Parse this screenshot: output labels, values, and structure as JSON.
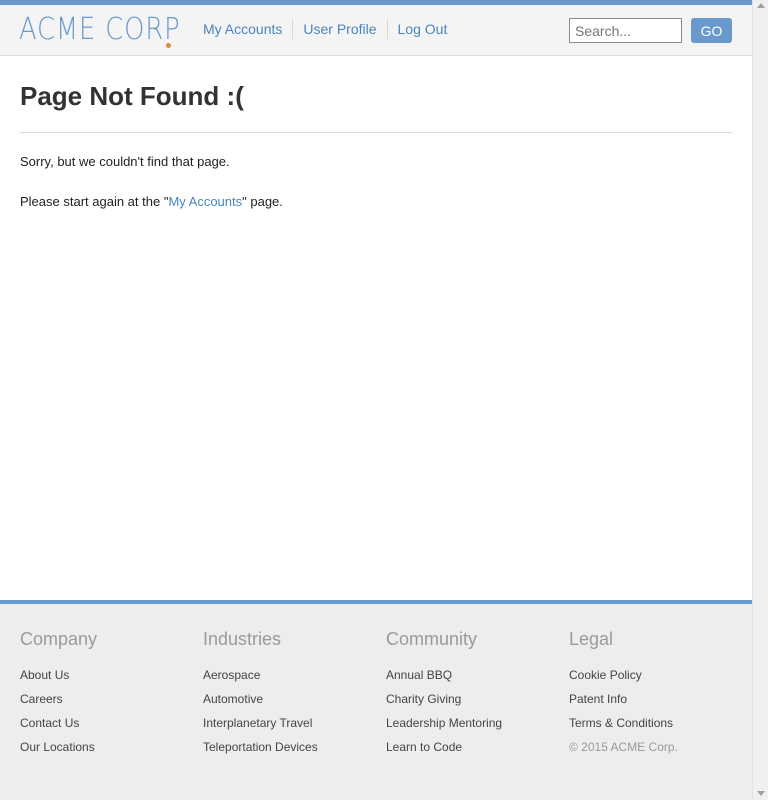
{
  "header": {
    "logo": "ACME CORP",
    "nav": [
      "My Accounts",
      "User Profile",
      "Log Out"
    ],
    "search": {
      "placeholder": "Search...",
      "value": ""
    },
    "go_label": "GO"
  },
  "main": {
    "title": "Page Not Found :(",
    "sorry_text": "Sorry, but we couldn't find that page.",
    "restart_prefix": "Please start again at the \"",
    "restart_link": "My Accounts",
    "restart_suffix": "\" page."
  },
  "footer": {
    "columns": [
      {
        "heading": "Company",
        "links": [
          "About Us",
          "Careers",
          "Contact Us",
          "Our Locations"
        ]
      },
      {
        "heading": "Industries",
        "links": [
          "Aerospace",
          "Automotive",
          "Interplanetary Travel",
          "Teleportation Devices"
        ]
      },
      {
        "heading": "Community",
        "links": [
          "Annual BBQ",
          "Charity Giving",
          "Leadership Mentoring",
          "Learn to Code"
        ]
      },
      {
        "heading": "Legal",
        "links": [
          "Cookie Policy",
          "Patent Info",
          "Terms & Conditions"
        ]
      }
    ],
    "copyright": "© 2015 ACME Corp."
  },
  "colors": {
    "accent": "#6a99cb",
    "logo_dot": "#e38a34",
    "link": "#4a85c0",
    "footer_bg": "#ededed",
    "header_bg": "#f4f4f4"
  },
  "icons": {
    "scroll_up": "triangle-up",
    "scroll_down": "triangle-down"
  }
}
